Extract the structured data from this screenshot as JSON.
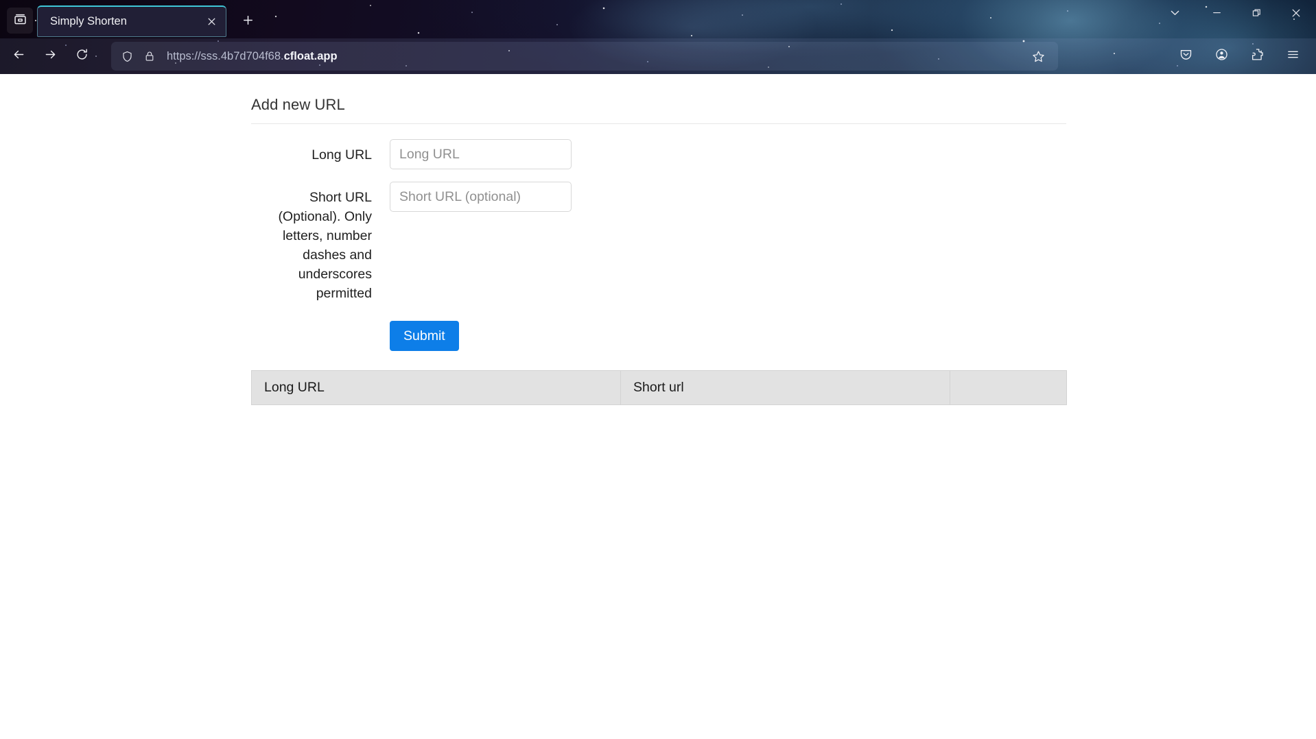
{
  "browser": {
    "firefox_view_label": "Firefox View",
    "tabs": [
      {
        "title": "Simply Shorten",
        "active": true,
        "close_label": "Close tab"
      }
    ],
    "new_tab_label": "New tab",
    "window_controls": {
      "tab_list": "List all tabs",
      "minimize": "Minimize",
      "maximize": "Restore down",
      "close": "Close"
    },
    "nav": {
      "back": "Back",
      "forward": "Forward",
      "reload": "Reload"
    },
    "urlbar": {
      "scheme_path": "https://sss.4b7d704f68.",
      "host": "cfloat.app",
      "full_url": "https://sss.4b7d704f68.cfloat.app",
      "shield_label": "Tracking protection",
      "lock_label": "Secure connection",
      "bookmark_label": "Bookmark this page"
    },
    "toolbar_right": [
      {
        "name": "pocket-icon",
        "label": "Save to Pocket"
      },
      {
        "name": "account-icon",
        "label": "Account"
      },
      {
        "name": "extensions-icon",
        "label": "Extensions"
      },
      {
        "name": "app-menu-icon",
        "label": "Open application menu"
      }
    ]
  },
  "page": {
    "section_title": "Add new URL",
    "form": {
      "long_url": {
        "label": "Long URL",
        "placeholder": "Long URL",
        "value": ""
      },
      "short_url": {
        "label": "Short URL (Optional). Only letters, number dashes and underscores permitted",
        "placeholder": "Short URL (optional)",
        "value": ""
      },
      "submit_label": "Submit"
    },
    "table": {
      "columns": [
        "Long URL",
        "Short url",
        ""
      ],
      "rows": []
    }
  },
  "colors": {
    "accent_blue": "#0d7ee8",
    "tab_accent": "#3fc7d8",
    "table_header_bg": "#e2e2e2",
    "border_gray": "#d3d3d3"
  }
}
